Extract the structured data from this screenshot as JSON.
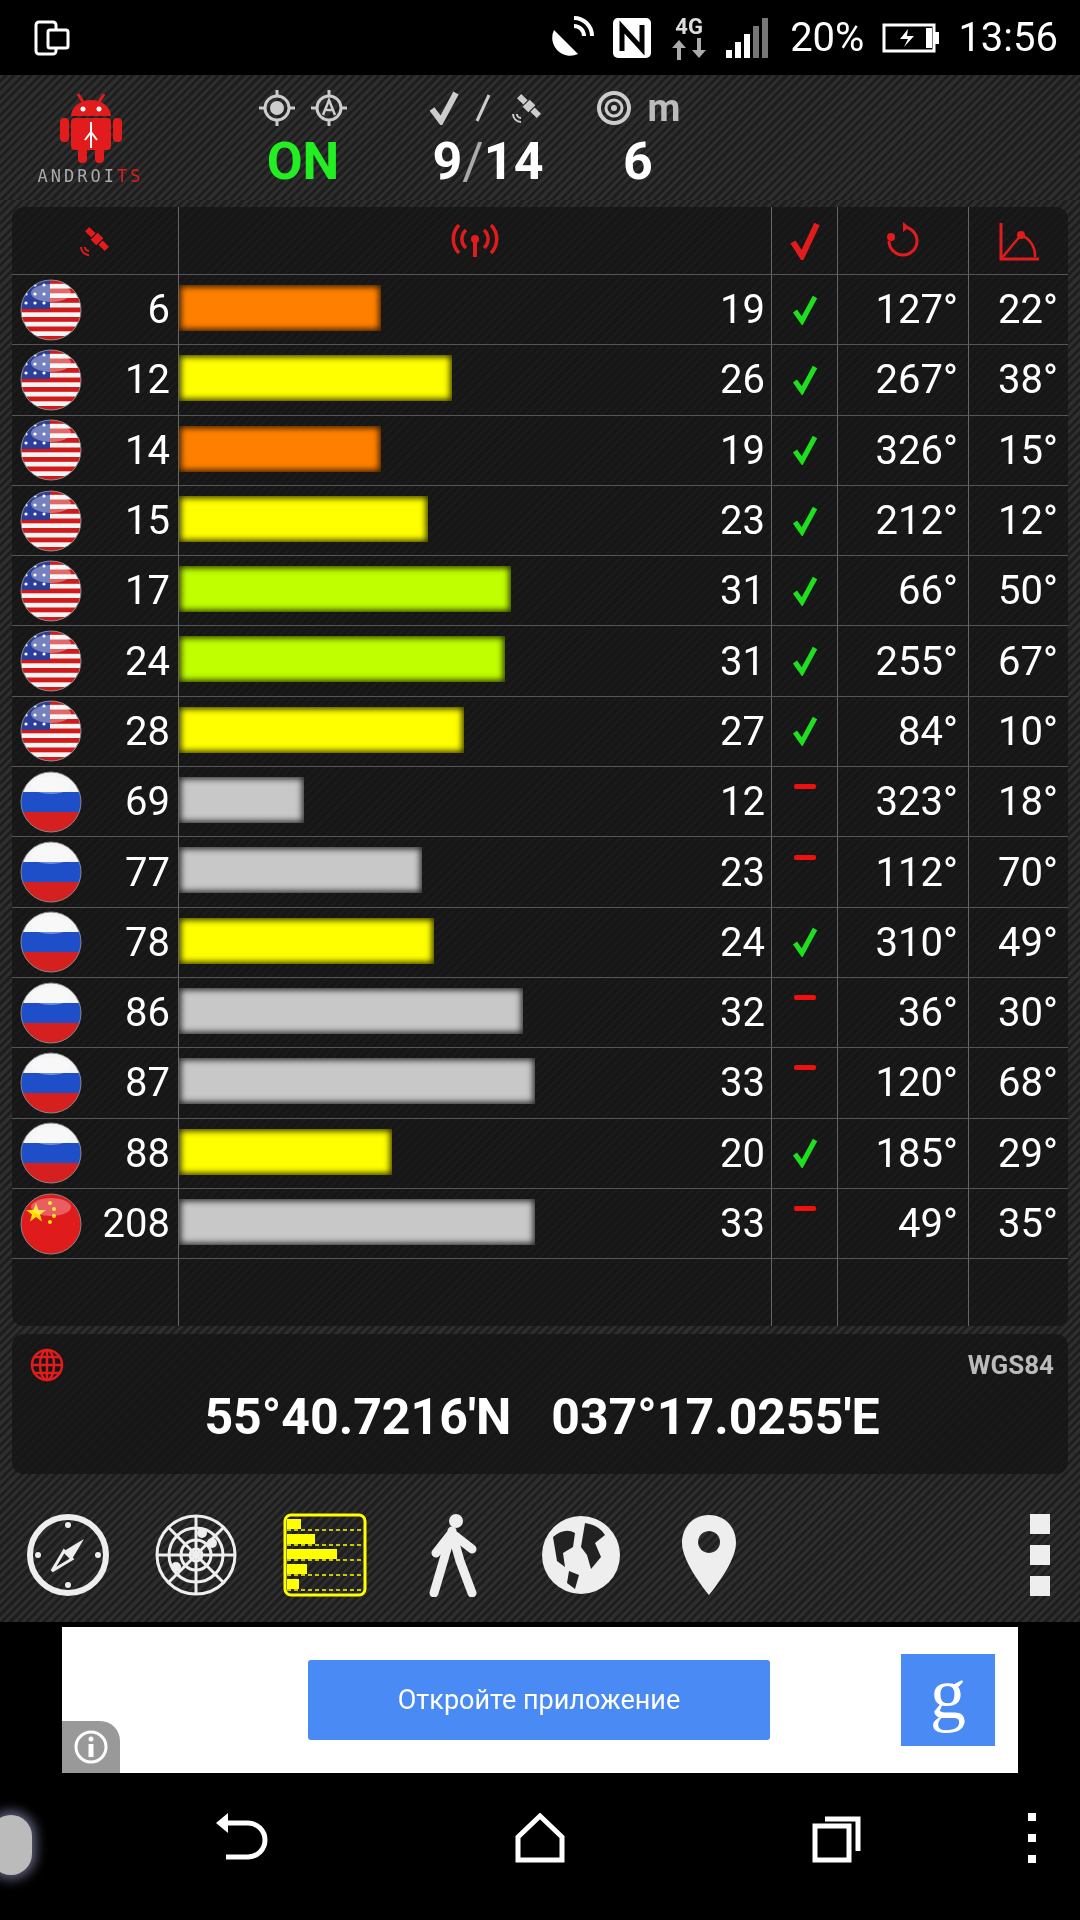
{
  "status_bar": {
    "network": "4G",
    "battery": "20%",
    "time": "13:56"
  },
  "header": {
    "logo": {
      "main": "ANDROI",
      "accent": "TS"
    },
    "fix": "ON",
    "used": "9",
    "separator": "/",
    "visible": "14",
    "accuracy_unit": "m",
    "accuracy": "6"
  },
  "satellites": [
    {
      "kind": "us",
      "prn": "6",
      "snr": "19",
      "level": 0.34,
      "color": "#ff8000",
      "used": true,
      "azimuth": "127°",
      "elevation": "22°"
    },
    {
      "kind": "us",
      "prn": "12",
      "snr": "26",
      "level": 0.46,
      "color": "#ffff00",
      "used": true,
      "azimuth": "267°",
      "elevation": "38°"
    },
    {
      "kind": "us",
      "prn": "14",
      "snr": "19",
      "level": 0.34,
      "color": "#ff8000",
      "used": true,
      "azimuth": "326°",
      "elevation": "15°"
    },
    {
      "kind": "us",
      "prn": "15",
      "snr": "23",
      "level": 0.42,
      "color": "#ffff00",
      "used": true,
      "azimuth": "212°",
      "elevation": "12°"
    },
    {
      "kind": "us",
      "prn": "17",
      "snr": "31",
      "level": 0.56,
      "color": "#c0ff00",
      "used": true,
      "azimuth": "66°",
      "elevation": "50°"
    },
    {
      "kind": "us",
      "prn": "24",
      "snr": "31",
      "level": 0.55,
      "color": "#c0ff00",
      "used": true,
      "azimuth": "255°",
      "elevation": "67°"
    },
    {
      "kind": "us",
      "prn": "28",
      "snr": "27",
      "level": 0.48,
      "color": "#ffff00",
      "used": true,
      "azimuth": "84°",
      "elevation": "10°"
    },
    {
      "kind": "ru",
      "prn": "69",
      "snr": "12",
      "level": 0.21,
      "color": "#c8c8c8",
      "used": false,
      "azimuth": "323°",
      "elevation": "18°"
    },
    {
      "kind": "ru",
      "prn": "77",
      "snr": "23",
      "level": 0.41,
      "color": "#c8c8c8",
      "used": false,
      "azimuth": "112°",
      "elevation": "70°"
    },
    {
      "kind": "ru",
      "prn": "78",
      "snr": "24",
      "level": 0.43,
      "color": "#ffff00",
      "used": true,
      "azimuth": "310°",
      "elevation": "49°"
    },
    {
      "kind": "ru",
      "prn": "86",
      "snr": "32",
      "level": 0.58,
      "color": "#c8c8c8",
      "used": false,
      "azimuth": "36°",
      "elevation": "30°"
    },
    {
      "kind": "ru",
      "prn": "87",
      "snr": "33",
      "level": 0.6,
      "color": "#c8c8c8",
      "used": false,
      "azimuth": "120°",
      "elevation": "68°"
    },
    {
      "kind": "ru",
      "prn": "88",
      "snr": "20",
      "level": 0.36,
      "color": "#ffff00",
      "used": true,
      "azimuth": "185°",
      "elevation": "29°"
    },
    {
      "kind": "cn",
      "prn": "208",
      "snr": "33",
      "level": 0.6,
      "color": "#c8c8c8",
      "used": false,
      "azimuth": "49°",
      "elevation": "35°"
    }
  ],
  "position": {
    "datum": "WGS84",
    "latitude": "55°40.7216'N",
    "longitude": "037°17.0255'E"
  },
  "toolbar": [
    {
      "kind": "compass",
      "selected": false
    },
    {
      "kind": "radar",
      "selected": false
    },
    {
      "kind": "bars",
      "selected": true
    },
    {
      "kind": "walker",
      "selected": false
    },
    {
      "kind": "globe",
      "selected": false
    },
    {
      "kind": "pin",
      "selected": false
    },
    {
      "kind": "more",
      "selected": false
    }
  ],
  "ad": {
    "button": "Откройте приложение",
    "logo": "g"
  }
}
